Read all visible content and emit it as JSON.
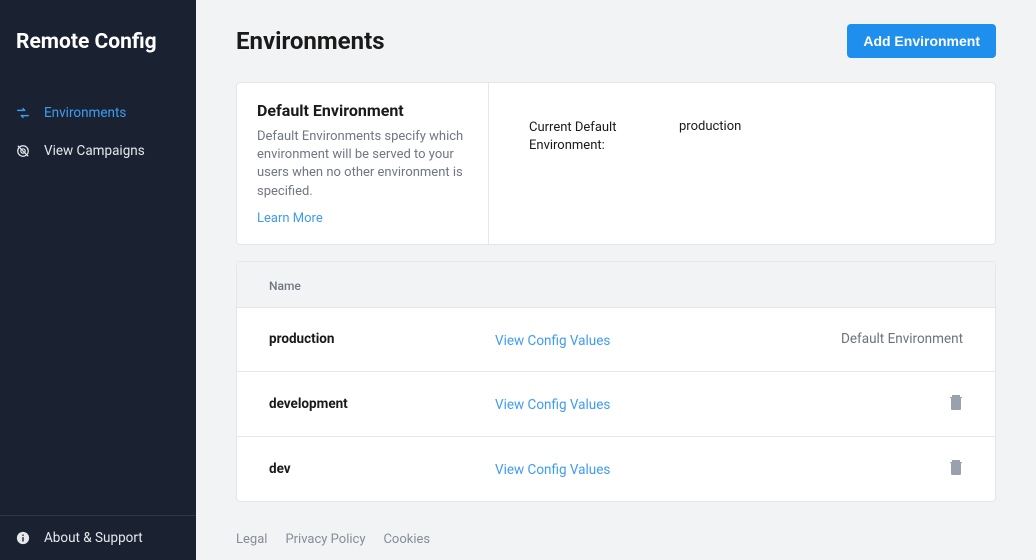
{
  "sidebar": {
    "title": "Remote Config",
    "nav": [
      {
        "label": "Environments",
        "icon": "swap"
      },
      {
        "label": "View Campaigns",
        "icon": "target"
      }
    ],
    "footer": {
      "label": "About & Support",
      "icon": "info"
    }
  },
  "main": {
    "page_title": "Environments",
    "add_button": "Add Environment",
    "default_card": {
      "title": "Default Environment",
      "description": "Default Environments specify which environment will be served to your users when no other environment is specified.",
      "learn_more": "Learn More",
      "current_label": "Current Default Environment:",
      "current_value": "production"
    },
    "table": {
      "header_name": "Name",
      "rows": [
        {
          "name": "production",
          "action": "View Config Values",
          "right_text": "Default Environment",
          "deletable": false
        },
        {
          "name": "development",
          "action": "View Config Values",
          "right_text": "",
          "deletable": true
        },
        {
          "name": "dev",
          "action": "View Config Values",
          "right_text": "",
          "deletable": true
        }
      ]
    },
    "footer_links": [
      "Legal",
      "Privacy Policy",
      "Cookies"
    ]
  }
}
